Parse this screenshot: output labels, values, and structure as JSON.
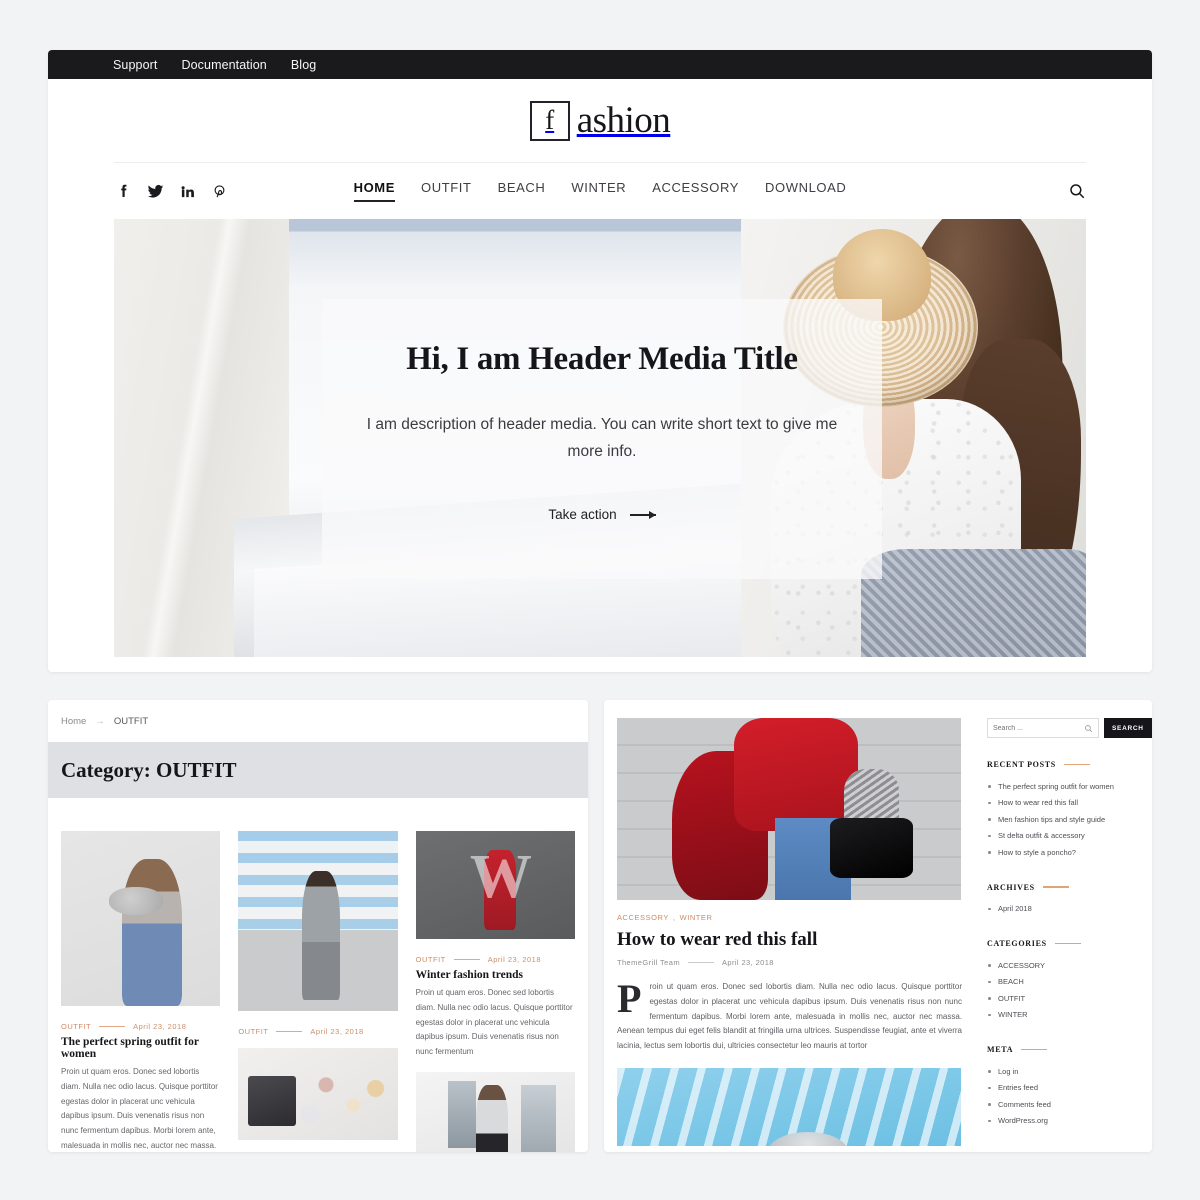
{
  "topbar": {
    "links": [
      "Support",
      "Documentation",
      "Blog"
    ]
  },
  "logo": {
    "mark": "f",
    "word": "ashion"
  },
  "social": [
    {
      "name": "facebook-icon"
    },
    {
      "name": "twitter-icon"
    },
    {
      "name": "linkedin-icon"
    },
    {
      "name": "pinterest-icon"
    }
  ],
  "menu": {
    "items": [
      "HOME",
      "OUTFIT",
      "BEACH",
      "WINTER",
      "ACCESSORY",
      "DOWNLOAD"
    ],
    "active": "HOME"
  },
  "hero": {
    "title": "Hi, I am Header Media Title",
    "description": "I am description of header media. You can write short text to give me more info.",
    "cta": "Take action"
  },
  "breadcrumb": {
    "home": "Home",
    "separator": "→",
    "current": "OUTFIT"
  },
  "category": {
    "heading": "Category: OUTFIT"
  },
  "posts": [
    {
      "category": "OUTFIT",
      "date": "April 23, 2018",
      "title": "The perfect spring outfit for women",
      "excerpt": "Proin ut quam eros. Donec sed lobortis diam. Nulla nec odio lacus. Quisque porttitor egestas dolor in placerat unc vehicula dapibus ipsum. Duis venenatis risus non nunc fermentum dapibus. Morbi lorem ante, malesuada in mollis nec, auctor nec massa. Aenean tempus dui eget felis blandit at fringilla urna ultrices."
    },
    {
      "category": "OUTFIT",
      "date": "April 23, 2018",
      "title": "",
      "excerpt": ""
    },
    {
      "category": "OUTFIT",
      "date": "April 23, 2018",
      "title": "Winter fashion trends",
      "excerpt": "Proin ut quam eros. Donec sed lobortis diam. Nulla nec odio lacus. Quisque porttitor egestas dolor in placerat unc vehicula dapibus ipsum. Duis venenatis risus non nunc fermentum"
    }
  ],
  "article": {
    "categories": [
      "ACCESSORY",
      "WINTER"
    ],
    "categories_sep": ",",
    "title": "How to wear red this fall",
    "author": "ThemeGrill Team",
    "date": "April 23, 2018",
    "body": "Proin ut quam eros. Donec sed lobortis diam. Nulla nec odio lacus. Quisque porttitor egestas dolor in placerat unc vehicula dapibus ipsum. Duis venenatis risus non nunc fermentum dapibus. Morbi lorem ante, malesuada in mollis nec, auctor nec massa. Aenean tempus dui eget felis blandit at fringilla urna ultrices. Suspendisse feugiat, ante et viverra lacinia, lectus sem lobortis dui, ultricies consectetur leo mauris at tortor"
  },
  "sidebar": {
    "search": {
      "placeholder": "Search ...",
      "value": "",
      "button": "SEARCH"
    },
    "widgets": [
      {
        "title": "RECENT POSTS",
        "items": [
          "The perfect spring outfit for women",
          "How to wear red this fall",
          "Men fashion tips and style guide",
          "St delta outfit & accessory",
          "How to style a poncho?"
        ]
      },
      {
        "title": "ARCHIVES",
        "items": [
          "April 2018"
        ]
      },
      {
        "title": "CATEGORIES",
        "items": [
          "ACCESSORY",
          "BEACH",
          "OUTFIT",
          "WINTER"
        ]
      },
      {
        "title": "META",
        "items": [
          "Log in",
          "Entries feed",
          "Comments feed",
          "WordPress.org"
        ]
      }
    ]
  },
  "colors": {
    "topbar_bg": "#1a1a1c",
    "accent": "#d08b66",
    "banner_bg": "#dfe0e3",
    "page_bg": "#f2f3f5"
  }
}
